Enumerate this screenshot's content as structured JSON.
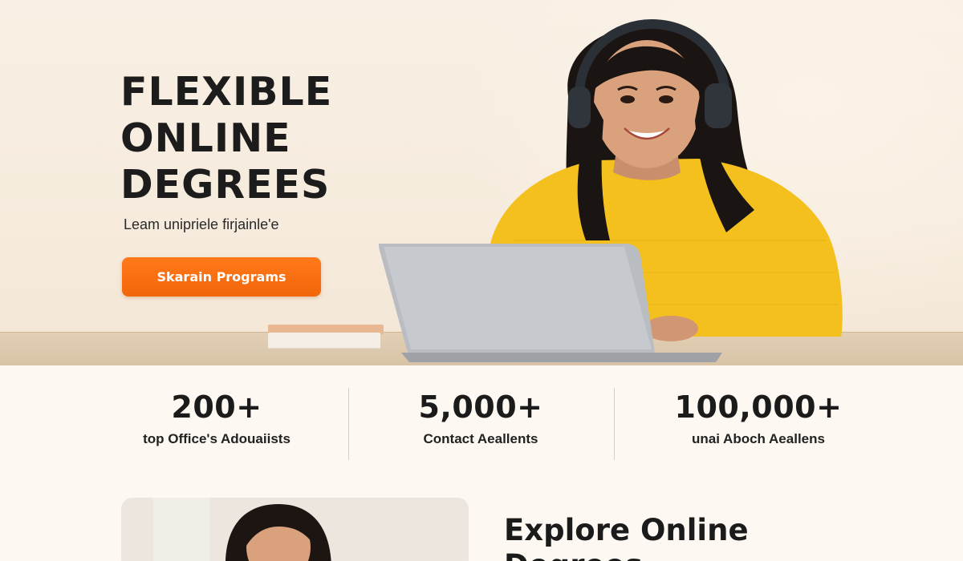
{
  "hero": {
    "title_lines": [
      "FLEXIBLE",
      "ONLINE",
      "DEGREES"
    ],
    "subtitle": "Leam unipriele firjainle'e",
    "cta_label": "Skarain Programs"
  },
  "stats": [
    {
      "value": "200+",
      "label": "top Office's Adouaiists"
    },
    {
      "value": "5,000+",
      "label": "Contact Aeallents"
    },
    {
      "value": "100,000+",
      "label": "unai Aboch Aeallens"
    }
  ],
  "explore": {
    "title": "Explore Online Degrees"
  },
  "colors": {
    "accent": "#f2650a",
    "background": "#fdf8f1",
    "text": "#1d1d1d",
    "sweater": "#f3c01e"
  }
}
